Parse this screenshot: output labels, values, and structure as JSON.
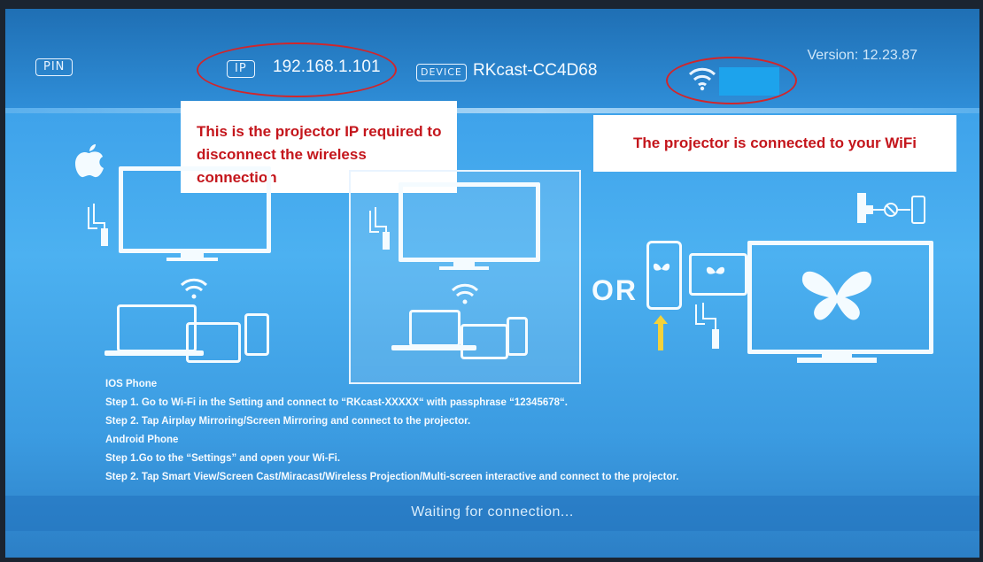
{
  "header": {
    "pin_label": "PIN",
    "ip_label": "IP",
    "ip_value": "192.168.1.101",
    "device_label": "DEVICE",
    "device_value": "RKcast-CC4D68",
    "version": "Version:  12.23.87"
  },
  "callouts": {
    "ip_note": "This is the projector IP required to disconnect the wireless connection",
    "wifi_note": "The projector is connected to your WiFi"
  },
  "center": {
    "or_label": "OR"
  },
  "instructions": {
    "ios_title": "IOS Phone",
    "ios_step1": "Step 1. Go to Wi-Fi in the Setting and connect to “RKcast-XXXXX“ with passphrase “12345678“.",
    "ios_step2": "Step 2. Tap Airplay Mirroring/Screen Mirroring and connect to the projector.",
    "android_title": "Android Phone",
    "android_step1": "Step 1.Go to the “Settings” and open your Wi-Fi.",
    "android_step2": "Step 2. Tap Smart View/Screen Cast/Miracast/Wireless Projection/Multi-screen interactive and connect to the projector."
  },
  "status": {
    "waiting": "Waiting for connection..."
  },
  "colors": {
    "background": "#3ea2ea",
    "header": "#1f6fb4",
    "annotation": "#d1262b",
    "ssid_mask": "#1da3ec"
  },
  "icons": [
    "apple-icon",
    "wifi-icon",
    "tv-icon",
    "laptop-icon",
    "tablet-icon",
    "phone-icon",
    "usb-icon",
    "butterfly-icon",
    "hdmi-cable-icon"
  ]
}
